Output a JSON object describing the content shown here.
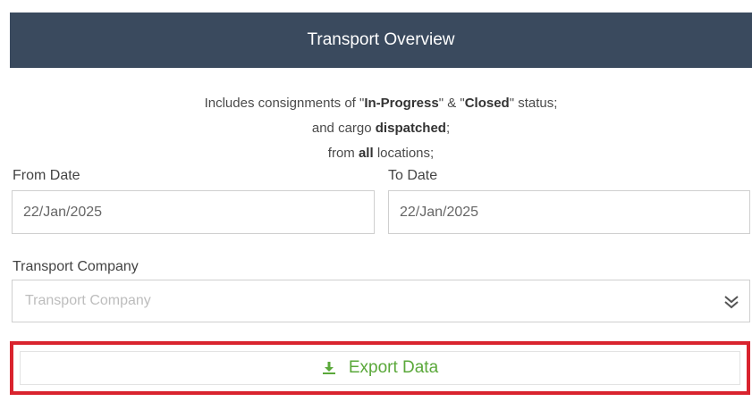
{
  "header": {
    "title": "Transport Overview"
  },
  "info": {
    "line1_pre": "Includes consignments of \"",
    "line1_b1": "In-Progress",
    "line1_mid": "\" & \"",
    "line1_b2": "Closed",
    "line1_post": "\" status;",
    "line2_pre": "and cargo ",
    "line2_b": "dispatched",
    "line2_post": ";",
    "line3_pre": "from ",
    "line3_b": "all",
    "line3_post": " locations;"
  },
  "from_date": {
    "label": "From Date",
    "value": "22/Jan/2025"
  },
  "to_date": {
    "label": "To Date",
    "value": "22/Jan/2025"
  },
  "transport_company": {
    "label": "Transport Company",
    "placeholder": "Transport Company"
  },
  "export": {
    "label": "Export Data"
  },
  "colors": {
    "header_bg": "#3a4a5e",
    "highlight_border": "#d9232e",
    "export_text": "#5aa83a"
  },
  "icons": {
    "export": "download-icon",
    "select": "double-chevron-down-icon"
  }
}
